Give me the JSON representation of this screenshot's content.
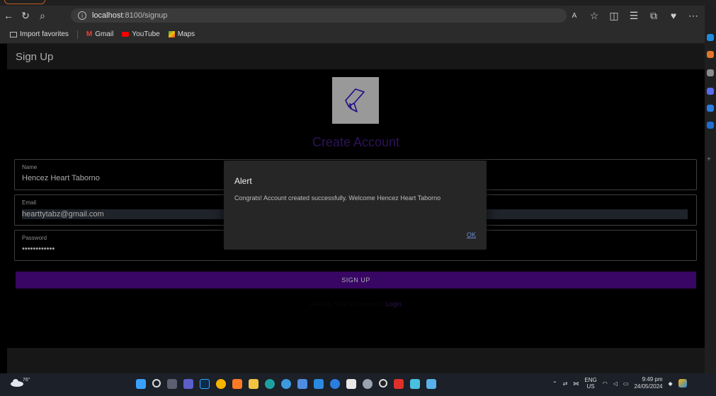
{
  "browser": {
    "url_host": "localhost",
    "url_rest": ":8100/signup",
    "favorites": [
      "Import favorites",
      "Gmail",
      "YouTube",
      "Maps"
    ]
  },
  "app": {
    "header_title": "Sign Up",
    "page_title": "Create Account",
    "name": {
      "label": "Name",
      "value": "Hencez Heart Taborno"
    },
    "email": {
      "label": "Email",
      "value": "hearttytabz@gmail.com"
    },
    "password": {
      "label": "Password",
      "value": "Hencez2024!!"
    },
    "signup_label": "SIGN UP",
    "login_prompt": "Already have an account?",
    "login_link": "Login"
  },
  "alert": {
    "title": "Alert",
    "message": "Congrats! Account created successfully. Welcome Hencez Heart Taborno",
    "ok_label": "OK"
  },
  "taskbar": {
    "temp": "76°",
    "lang_1": "ENG",
    "lang_2": "US",
    "time": "9:49 pm",
    "date": "24/05/2024"
  },
  "colors": {
    "accent": "#4a0a84",
    "title": "#3b1a78",
    "link": "#6c8fd9"
  }
}
